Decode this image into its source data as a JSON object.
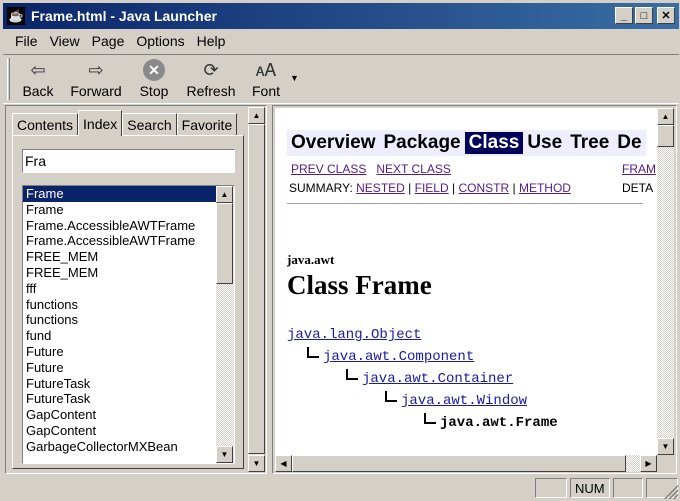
{
  "window": {
    "title": "Frame.html - Java Launcher",
    "app_icon": "java-icon",
    "controls": {
      "minimize": "_",
      "maximize": "□",
      "close": "✕"
    }
  },
  "menu": [
    "File",
    "View",
    "Page",
    "Options",
    "Help"
  ],
  "toolbar": {
    "buttons": [
      {
        "label": "Back",
        "icon": "back-arrow-icon",
        "glyph": "⇦"
      },
      {
        "label": "Forward",
        "icon": "forward-arrow-icon",
        "glyph": "⇨"
      },
      {
        "label": "Stop",
        "icon": "stop-icon",
        "glyph": "✕"
      },
      {
        "label": "Refresh",
        "icon": "refresh-icon",
        "glyph": "⟳"
      },
      {
        "label": "Font",
        "icon": "font-icon",
        "glyph": "🗚"
      }
    ],
    "dropdown_glyph": "▼"
  },
  "left_pane": {
    "tabs": [
      "Contents",
      "Index",
      "Search",
      "Favorite"
    ],
    "active_tab": "Index",
    "search_value": "Fra",
    "index_items": [
      "Frame",
      "Frame",
      "Frame.AccessibleAWTFrame",
      "Frame.AccessibleAWTFrame",
      "FREE_MEM",
      "FREE_MEM",
      "fff",
      "functions",
      "functions",
      "fund",
      "Future",
      "Future",
      "FutureTask",
      "FutureTask",
      "GapContent",
      "GapContent",
      "GarbageCollectorMXBean"
    ],
    "selected_index": 0
  },
  "doc": {
    "nav_links": [
      "Overview",
      "Package",
      "Class",
      "Use",
      "Tree",
      "De"
    ],
    "active_nav": "Class",
    "subnav": {
      "prev": "PREV CLASS",
      "next": "NEXT CLASS",
      "frames": "FRAM"
    },
    "summary": {
      "label": "SUMMARY:",
      "nested": "NESTED",
      "field": "FIELD",
      "constr": "CONSTR",
      "method": "METHOD",
      "sep": "|",
      "detail": "DETA"
    },
    "package": "java.awt",
    "class_title": "Class Frame",
    "hierarchy": [
      "java.lang.Object",
      "java.awt.Component",
      "java.awt.Container",
      "java.awt.Window",
      "java.awt.Frame"
    ]
  },
  "statusbar": {
    "num": "NUM"
  },
  "colors": {
    "title_start": "#0a246a",
    "title_end": "#3a6ea5",
    "nav_bg": "#eeeeff",
    "nav_active": "#00005a",
    "link": "#1a1aa6",
    "visited": "#551a8b"
  }
}
